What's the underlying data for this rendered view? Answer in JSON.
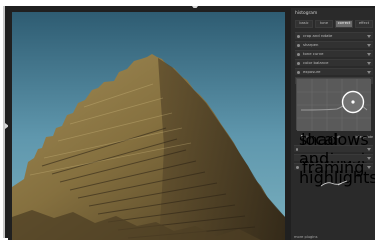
{
  "panel": {
    "title": "histogram",
    "tabs": [
      "basic",
      "tone",
      "correct",
      "effect"
    ]
  },
  "modules": [
    "crop and rotate",
    "sharpen",
    "tone curve",
    "color balance",
    "exposure",
    "equalizer II"
  ],
  "curve_controls": {
    "left": "linear",
    "middle": "smooth",
    "right": "interpolate"
  },
  "lower_modules": [
    "local contrast",
    "shadows and highlights",
    "framing"
  ],
  "footer": {
    "more": "more plugins"
  },
  "colors": {
    "accent": "#6a6a6a",
    "panel": "#2a2a2a",
    "photo_sky": "#6ea3b6",
    "rock": "#8a7440"
  },
  "icons": {
    "left_arrow": "left-arrow-icon",
    "top_arrow": "top-arrow-icon",
    "circle_handle": "circle-handle-icon"
  }
}
